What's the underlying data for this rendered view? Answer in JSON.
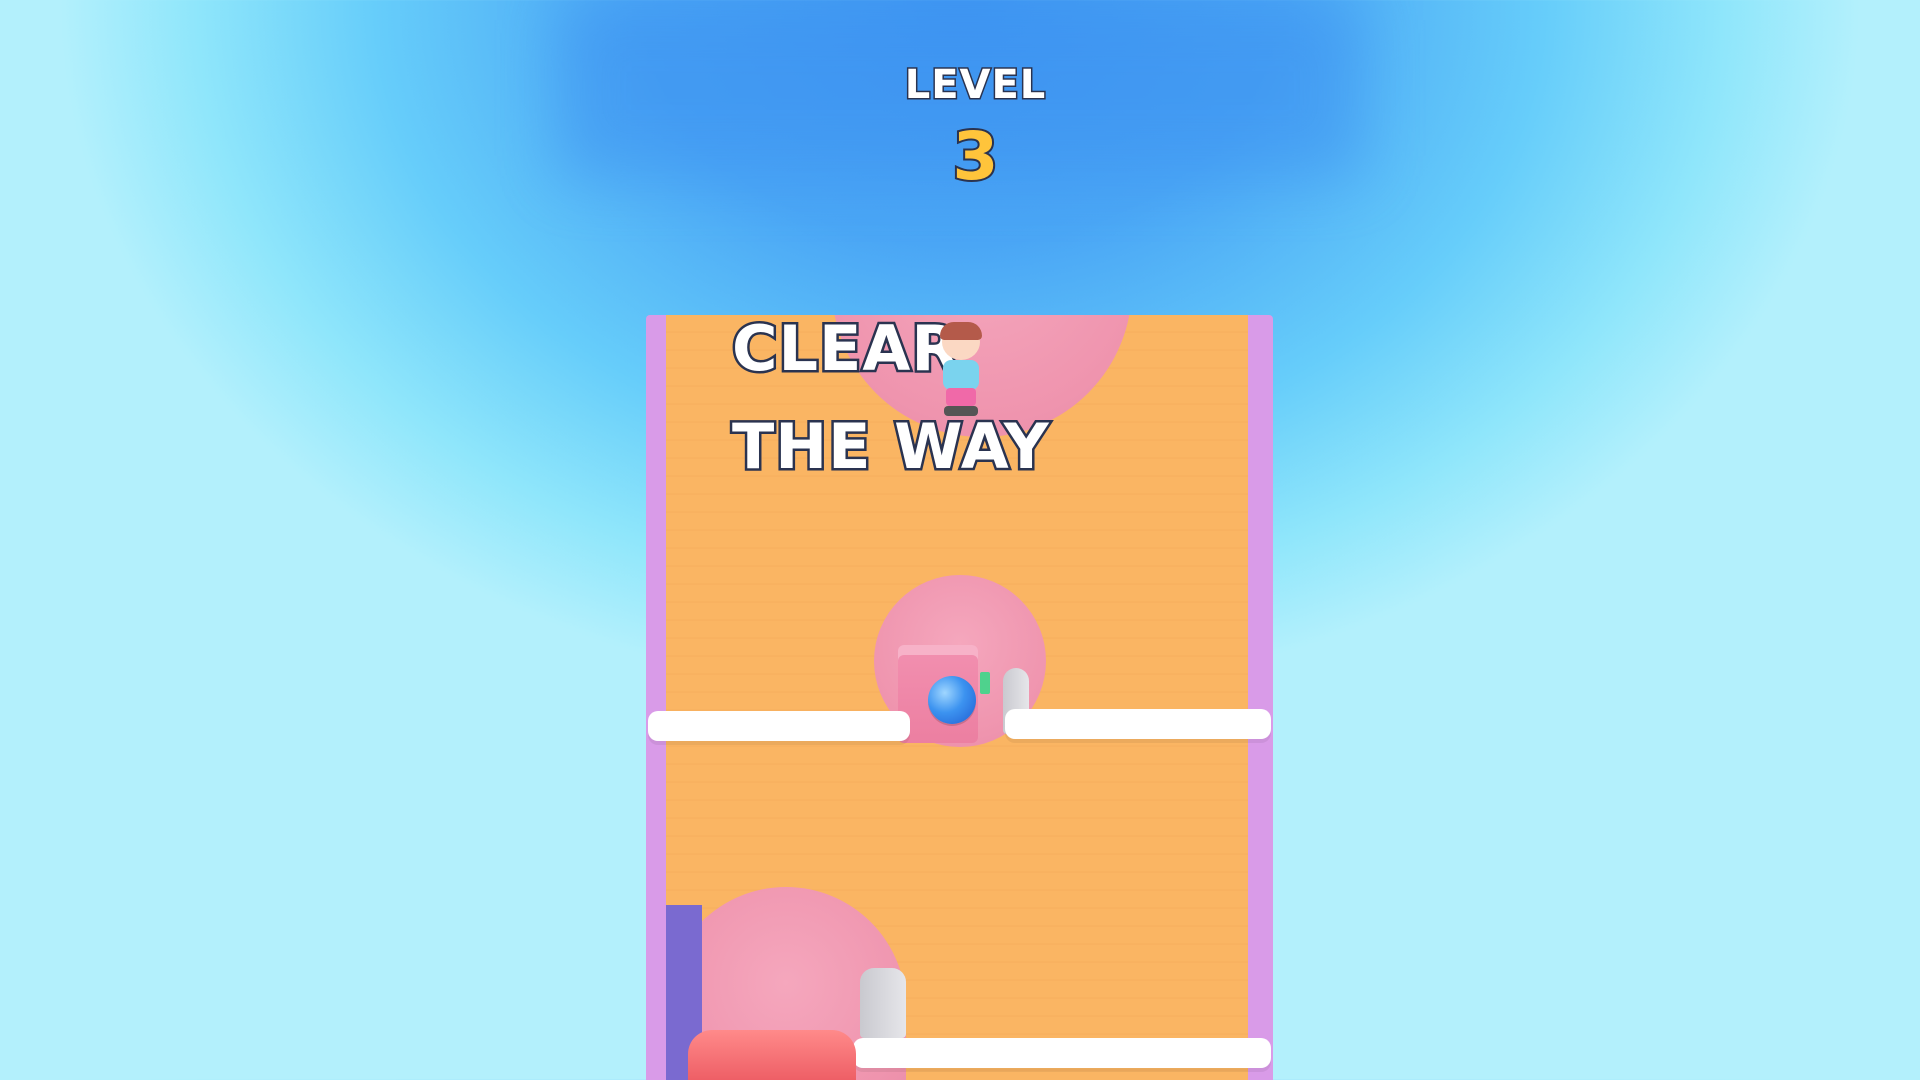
{
  "hud": {
    "level_label": "LEVEL",
    "level_number": "3"
  },
  "board": {
    "headline_line1": "CLEAR",
    "headline_line2": "THE WAY"
  },
  "icons": {
    "character": "character-icon",
    "ball": "ball-icon"
  },
  "colors": {
    "sky": "#4aa6f5",
    "board_floor": "#fab563",
    "board_walls": "#d99be8",
    "hole": "#ef94ae",
    "pins": "#ffffff",
    "level_number": "#ffc43b"
  }
}
